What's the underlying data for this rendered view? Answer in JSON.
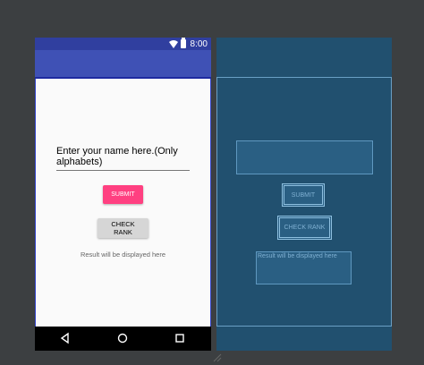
{
  "status_bar": {
    "time": "8:00"
  },
  "main": {
    "name_input": {
      "value": "Enter your name here.(Only alphabets)"
    },
    "submit_label": "SUBMIT",
    "check_rank_label": "CHECK RANK",
    "result_text": "Result will be displayed here"
  },
  "blueprint": {
    "submit_label": "SUBMIT",
    "check_rank_label": "CHECK RANK",
    "result_text": "Result will be displayed here"
  },
  "colors": {
    "status_bar": "#303f9f",
    "app_bar": "#3f51b5",
    "accent": "#ff4081",
    "blueprint": "#21506f"
  }
}
